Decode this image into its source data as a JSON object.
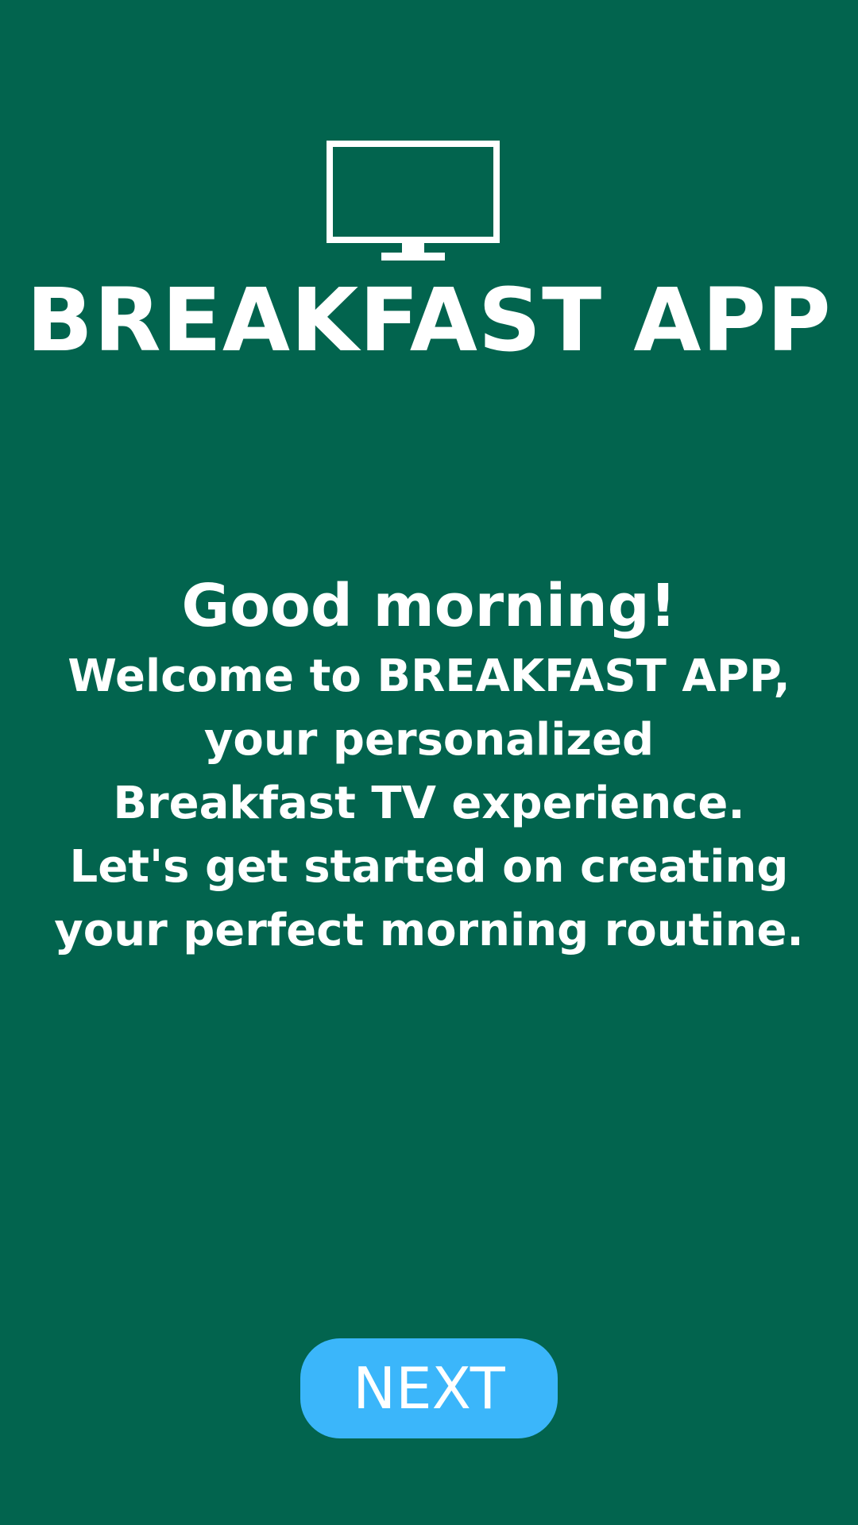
{
  "colors": {
    "background": "#02644e",
    "text": "#ffffff",
    "next_button_background": "#3bb6fa"
  },
  "header": {
    "icon": "tv-icon",
    "title": "BREAKFAST APP"
  },
  "welcome": {
    "greeting": "Good morning!",
    "lines": [
      "Welcome to BREAKFAST APP,",
      "your personalized",
      "Breakfast TV experience.",
      "Let's get started on creating",
      "your perfect morning routine."
    ]
  },
  "footer": {
    "next_label": "NEXT"
  }
}
